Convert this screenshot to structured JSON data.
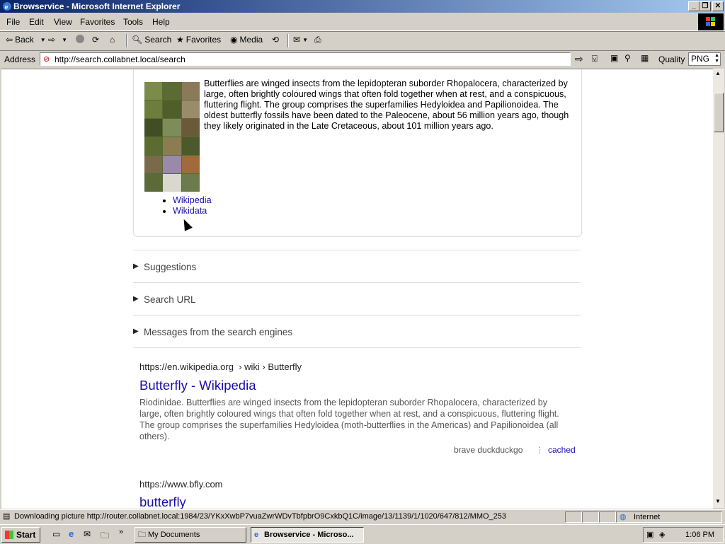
{
  "window": {
    "title": "Browservice - Microsoft Internet Explorer"
  },
  "menu": [
    "File",
    "Edit",
    "View",
    "Favorites",
    "Tools",
    "Help"
  ],
  "toolbar": {
    "back": "Back",
    "search": "Search",
    "favorites": "Favorites",
    "media": "Media"
  },
  "address": {
    "label": "Address",
    "url": "http://search.collabnet.local/search",
    "quality_label": "Quality",
    "quality_value": "PNG"
  },
  "infobox": {
    "text": "Butterflies are winged insects from the lepidopteran suborder Rhopalocera, characterized by large, often brightly coloured wings that often fold together when at rest, and a conspicuous, fluttering flight. The group comprises the superfamilies Hedyloidea and Papilionoidea. The oldest butterfly fossils have been dated to the Paleocene, about 56 million years ago, though they likely originated in the Late Cretaceous, about 101 million years ago.",
    "links": [
      "Wikipedia",
      "Wikidata"
    ]
  },
  "sections": [
    "Suggestions",
    "Search URL",
    "Messages from the search engines"
  ],
  "results": [
    {
      "url": "https://en.wikipedia.org",
      "path": "› wiki › Butterfly",
      "title": "Butterfly - Wikipedia",
      "snippet": "Riodinidae. Butterflies are winged insects from the lepidopteran suborder Rhopalocera, characterized by large, often brightly coloured wings that often fold together when at rest, and a conspicuous, fluttering flight. The group comprises the superfamilies Hedyloidea (moth-butterflies in the Americas) and Papilionoidea (all others).",
      "engines": "brave  duckduckgo",
      "cached": "cached"
    },
    {
      "url": "https://www.bfly.com",
      "title": "butterfly"
    }
  ],
  "status": {
    "text": "Downloading picture http://router.collabnet.local:1984/23/YKxXwbP7vuaZwrWDvTbfpbrO9CxkbQ1C/image/13/1139/1/1020/647/812/MMO_253",
    "zone": "Internet"
  },
  "taskbar": {
    "start": "Start",
    "tasks": [
      "My Documents",
      "Browservice - Microso..."
    ],
    "clock": "1:06 PM"
  }
}
